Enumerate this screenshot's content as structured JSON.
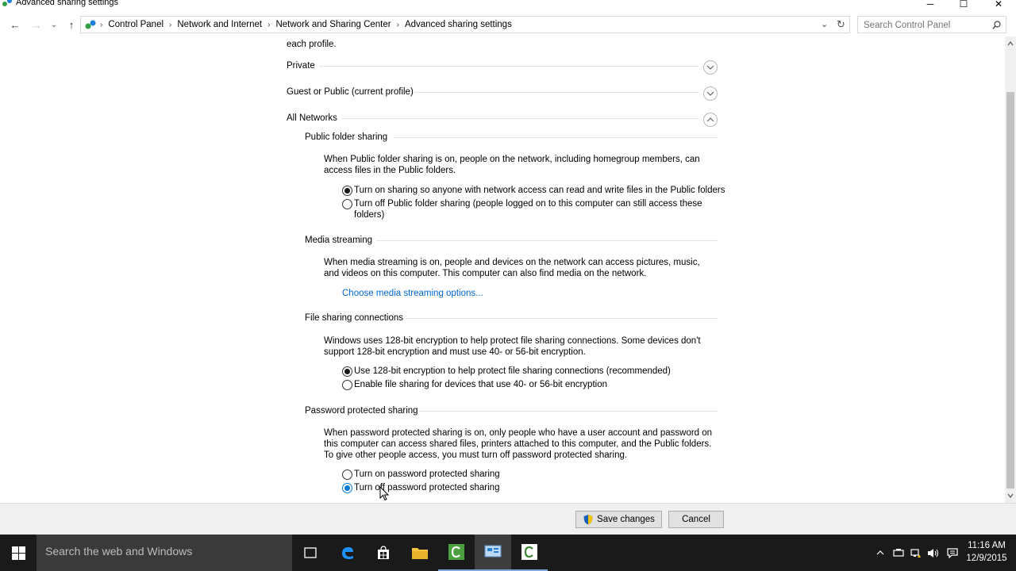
{
  "window": {
    "title": "Advanced sharing settings",
    "controls": {
      "minimize": "─",
      "maximize": "☐",
      "close": "✕"
    }
  },
  "nav": {
    "back": "←",
    "forward": "→",
    "recent": "⌄",
    "up": "↑",
    "breadcrumb": [
      "Control Panel",
      "Network and Internet",
      "Network and Sharing Center",
      "Advanced sharing settings"
    ],
    "separator": "›",
    "dropdown": "⌄",
    "refresh": "↻"
  },
  "search": {
    "placeholder": "Search Control Panel"
  },
  "content": {
    "intro": "each profile.",
    "profiles": {
      "private": "Private",
      "guest": "Guest or Public (current profile)",
      "all": "All Networks"
    },
    "public_folder": {
      "heading": "Public folder sharing",
      "desc": "When Public folder sharing is on, people on the network, including homegroup members, can access files in the Public folders.",
      "opt_on": "Turn on sharing so anyone with network access can read and write files in the Public folders",
      "opt_off": "Turn off Public folder sharing (people logged on to this computer can still access these folders)"
    },
    "media": {
      "heading": "Media streaming",
      "desc": "When media streaming is on, people and devices on the network can access pictures, music, and videos on this computer. This computer can also find media on the network.",
      "link": "Choose media streaming options..."
    },
    "file_sharing": {
      "heading": "File sharing connections",
      "desc": "Windows uses 128-bit encryption to help protect file sharing connections. Some devices don't support 128-bit encryption and must use 40- or 56-bit encryption.",
      "opt_128": "Use 128-bit encryption to help protect file sharing connections (recommended)",
      "opt_40": "Enable file sharing for devices that use 40- or 56-bit encryption"
    },
    "password": {
      "heading": "Password protected sharing",
      "desc": "When password protected sharing is on, only people who have a user account and password on this computer can access shared files, printers attached to this computer, and the Public folders. To give other people access, you must turn off password protected sharing.",
      "opt_on": "Turn on password protected sharing",
      "opt_off": "Turn off password protected sharing"
    }
  },
  "footer": {
    "save": "Save changes",
    "cancel": "Cancel"
  },
  "taskbar": {
    "search_placeholder": "Search the web and Windows",
    "time": "11:16 AM",
    "date": "12/9/2015"
  },
  "colors": {
    "accent": "#0078d7",
    "link": "#0066cc"
  }
}
